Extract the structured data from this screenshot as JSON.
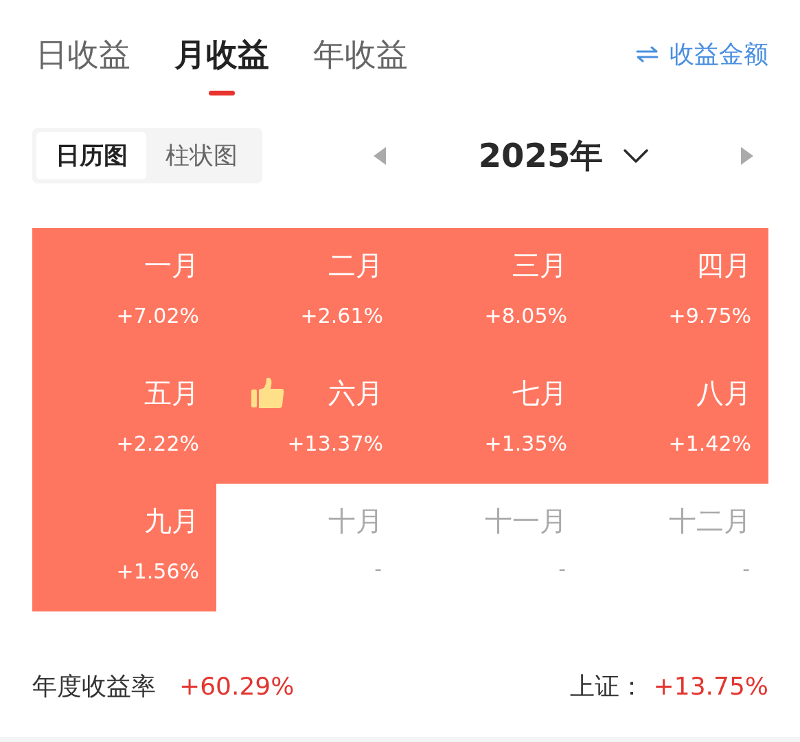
{
  "tabs": [
    {
      "label": "日收益",
      "selected": false
    },
    {
      "label": "月收益",
      "selected": true
    },
    {
      "label": "年收益",
      "selected": false
    }
  ],
  "switch_link": {
    "label": "收益金额"
  },
  "view_toggle": [
    {
      "label": "日历图",
      "selected": true
    },
    {
      "label": "柱状图",
      "selected": false
    }
  ],
  "year_picker": {
    "label": "2025年"
  },
  "months": [
    {
      "name": "一月",
      "value": "+7.02%",
      "kind": "gain",
      "best": false
    },
    {
      "name": "二月",
      "value": "+2.61%",
      "kind": "gain",
      "best": false
    },
    {
      "name": "三月",
      "value": "+8.05%",
      "kind": "gain",
      "best": false
    },
    {
      "name": "四月",
      "value": "+9.75%",
      "kind": "gain",
      "best": false
    },
    {
      "name": "五月",
      "value": "+2.22%",
      "kind": "gain",
      "best": false
    },
    {
      "name": "六月",
      "value": "+13.37%",
      "kind": "gain",
      "best": true
    },
    {
      "name": "七月",
      "value": "+1.35%",
      "kind": "gain",
      "best": false
    },
    {
      "name": "八月",
      "value": "+1.42%",
      "kind": "gain",
      "best": false
    },
    {
      "name": "九月",
      "value": "+1.56%",
      "kind": "gain",
      "best": false
    },
    {
      "name": "十月",
      "value": "-",
      "kind": "empty",
      "best": false
    },
    {
      "name": "十一月",
      "value": "-",
      "kind": "empty",
      "best": false
    },
    {
      "name": "十二月",
      "value": "-",
      "kind": "empty",
      "best": false
    }
  ],
  "summary": {
    "label": "年度收益率",
    "value": "+60.29%"
  },
  "benchmark": {
    "label": "上证：",
    "value": "+13.75%"
  }
}
